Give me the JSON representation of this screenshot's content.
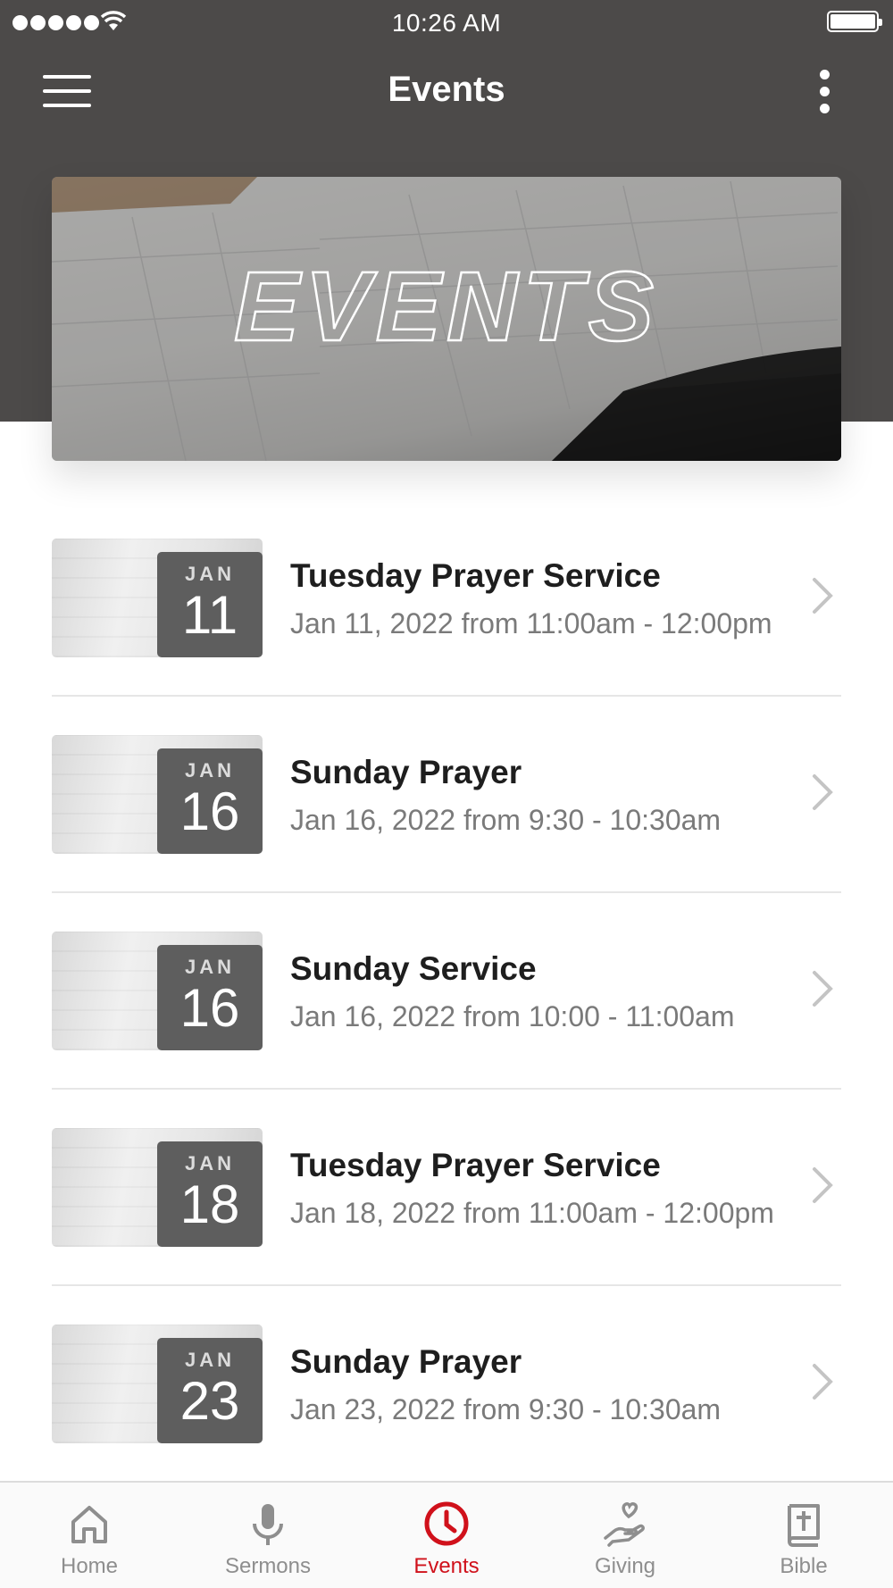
{
  "status_bar": {
    "time": "10:26 AM"
  },
  "nav": {
    "title": "Events"
  },
  "banner": {
    "text": "EVENTS"
  },
  "events": [
    {
      "month": "JAN",
      "day": "11",
      "title": "Tuesday Prayer Service",
      "time": "Jan 11, 2022 from 11:00am - 12:00pm"
    },
    {
      "month": "JAN",
      "day": "16",
      "title": "Sunday Prayer",
      "time": "Jan 16, 2022 from 9:30 - 10:30am"
    },
    {
      "month": "JAN",
      "day": "16",
      "title": "Sunday Service",
      "time": "Jan 16, 2022 from 10:00 - 11:00am"
    },
    {
      "month": "JAN",
      "day": "18",
      "title": "Tuesday Prayer Service",
      "time": "Jan 18, 2022 from 11:00am - 12:00pm"
    },
    {
      "month": "JAN",
      "day": "23",
      "title": "Sunday Prayer",
      "time": "Jan 23, 2022 from 9:30 - 10:30am"
    }
  ],
  "tabs": [
    {
      "label": "Home",
      "icon": "home-icon",
      "active": false
    },
    {
      "label": "Sermons",
      "icon": "microphone-icon",
      "active": false
    },
    {
      "label": "Events",
      "icon": "clock-icon",
      "active": true
    },
    {
      "label": "Giving",
      "icon": "giving-hand-heart-icon",
      "active": false
    },
    {
      "label": "Bible",
      "icon": "bible-icon",
      "active": false
    }
  ],
  "colors": {
    "header": "#4c4a49",
    "accent": "#d0111b",
    "inactive_tab": "#8e8e8e",
    "badge": "#5e5e5e"
  }
}
